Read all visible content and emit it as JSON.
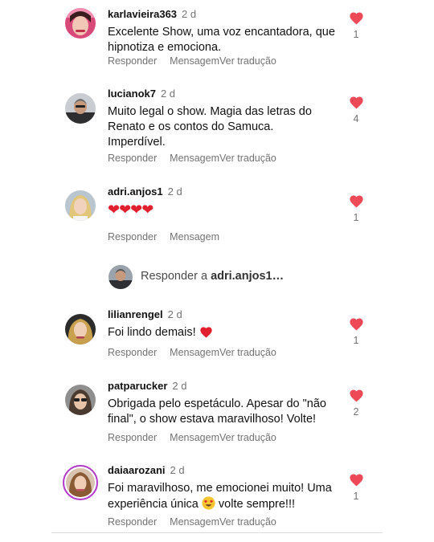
{
  "colors": {
    "heart": "#ed4956",
    "muted_text": "#737373",
    "story_ring": "#b238c8"
  },
  "comments": [
    {
      "username": "karlavieira363",
      "time": "2 d",
      "text": "Excelente Show, uma voz encantadora, que hipnotiza e emociona.",
      "reply_label": "Responder",
      "message_label": "Mensagem",
      "translate_label": "Ver tradução",
      "likes": "1",
      "avatar_icon": "profile-photo-woman-pink"
    },
    {
      "username": "lucianok7",
      "time": "2 d",
      "text": "Muito legal o show. Magia das letras do Renato e os contos do Samuca. Imperdível.",
      "reply_label": "Responder",
      "message_label": "Mensagem",
      "translate_label": "Ver tradução",
      "likes": "4",
      "avatar_icon": "profile-photo-man"
    },
    {
      "username": "adri.anjos1",
      "time": "2 d",
      "text": "❤❤❤❤",
      "reply_label": "Responder",
      "message_label": "Mensagem",
      "likes": "1",
      "avatar_icon": "profile-photo-blonde-woman"
    },
    {
      "username": "lilianrengel",
      "time": "2 d",
      "text": "Foi lindo demais! ",
      "reply_label": "Responder",
      "message_label": "Mensagem",
      "translate_label": "Ver tradução",
      "likes": "1",
      "avatar_icon": "profile-photo-woman-dark"
    },
    {
      "username": "patparucker",
      "time": "2 d",
      "text": "Obrigada pelo espetáculo. Apesar do \"não final\", o show estava maravilhoso! Volte!",
      "reply_label": "Responder",
      "message_label": "Mensagem",
      "translate_label": "Ver tradução",
      "likes": "2",
      "avatar_icon": "profile-photo-woman-sunglasses"
    },
    {
      "username": "daiaarozani",
      "time": "2 d",
      "text_before_emoji": "Foi maravilhoso, me emocionei muito! Uma experiência única ",
      "text_after_emoji": " volte sempre!!!",
      "reply_label": "Responder",
      "message_label": "Mensagem",
      "translate_label": "Ver tradução",
      "likes": "1",
      "avatar_icon": "profile-photo-woman-story-ring"
    }
  ],
  "reply_box": {
    "prefix": "Responder a ",
    "target": "adri.anjos1…"
  }
}
